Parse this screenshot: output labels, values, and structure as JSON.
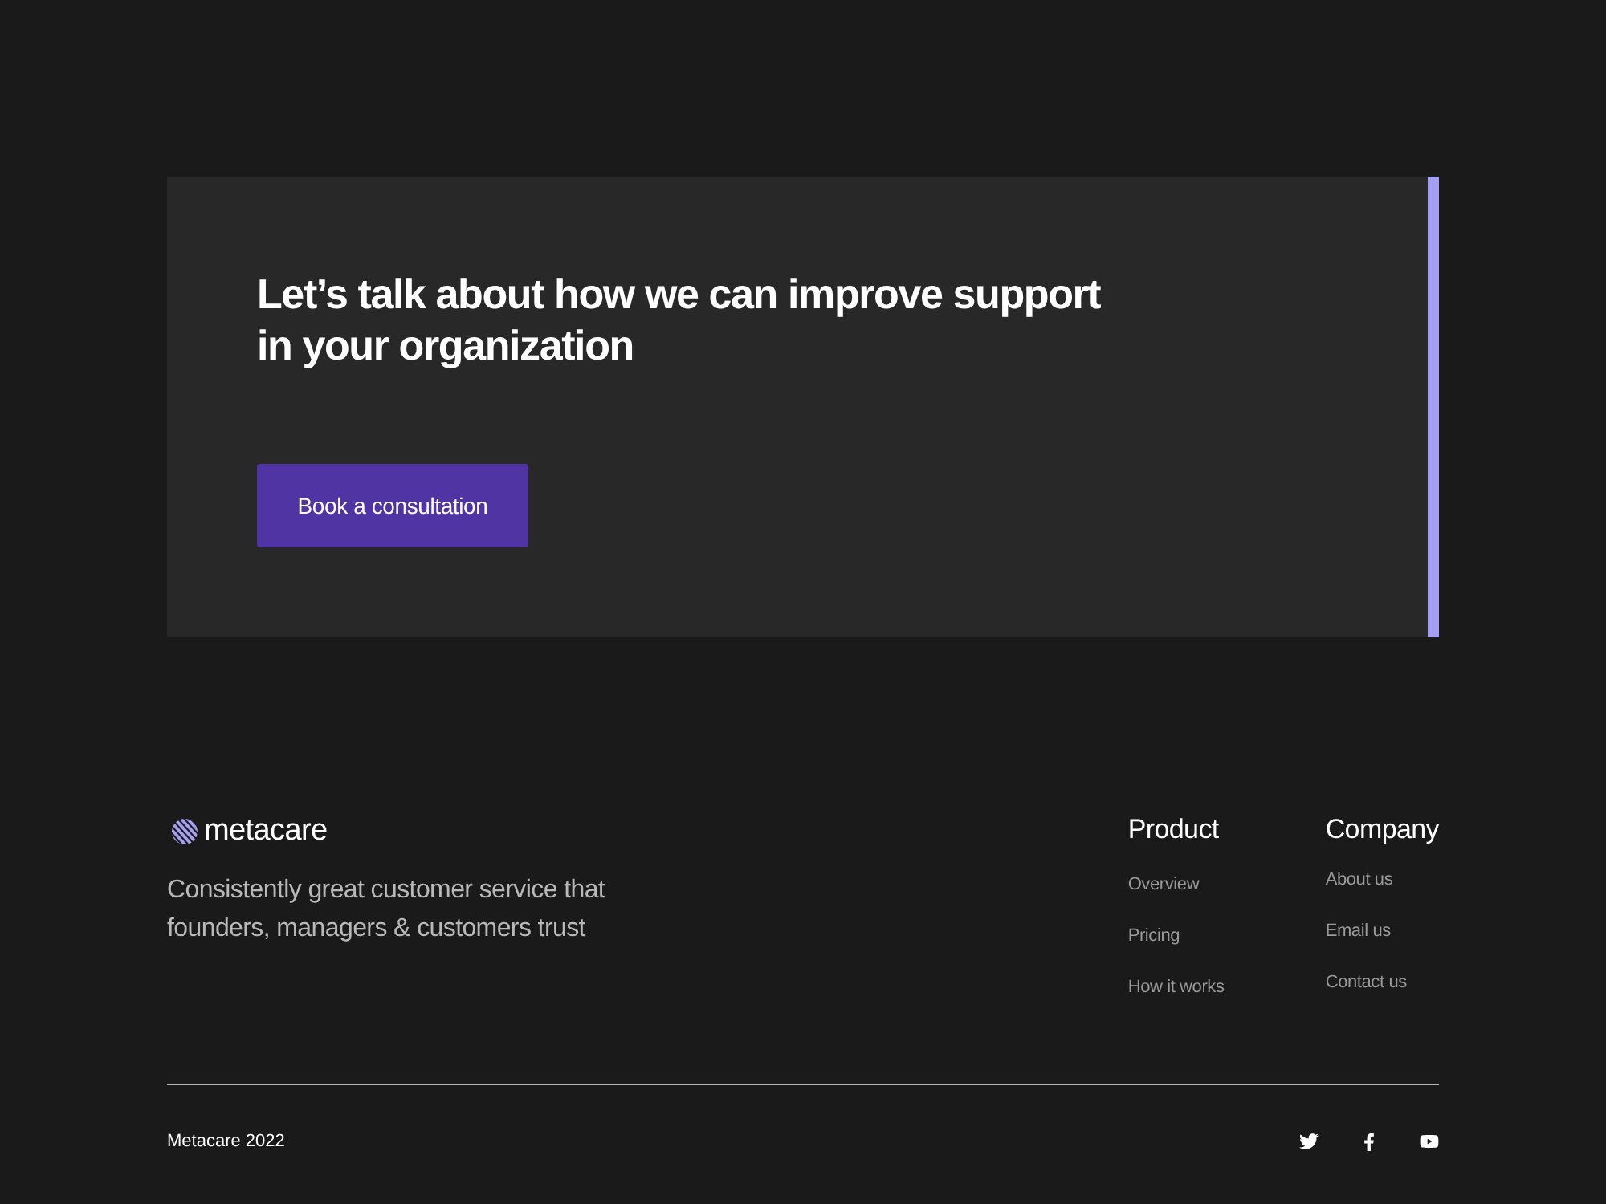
{
  "cta": {
    "heading": "Let’s talk about how we can improve support in your organization",
    "button": "Book a consultation"
  },
  "footer": {
    "brand": "metacare",
    "tagline": "Consistently great customer service that founders, managers & customers trust",
    "columns": [
      {
        "title": "Product",
        "links": [
          "Overview",
          "Pricing",
          "How it works"
        ]
      },
      {
        "title": "Company",
        "links": [
          "About us",
          "Email us",
          "Contact us"
        ]
      }
    ],
    "copyright": "Metacare 2022",
    "social": [
      {
        "kind": "twitter"
      },
      {
        "kind": "facebook"
      },
      {
        "kind": "youtube"
      }
    ]
  }
}
